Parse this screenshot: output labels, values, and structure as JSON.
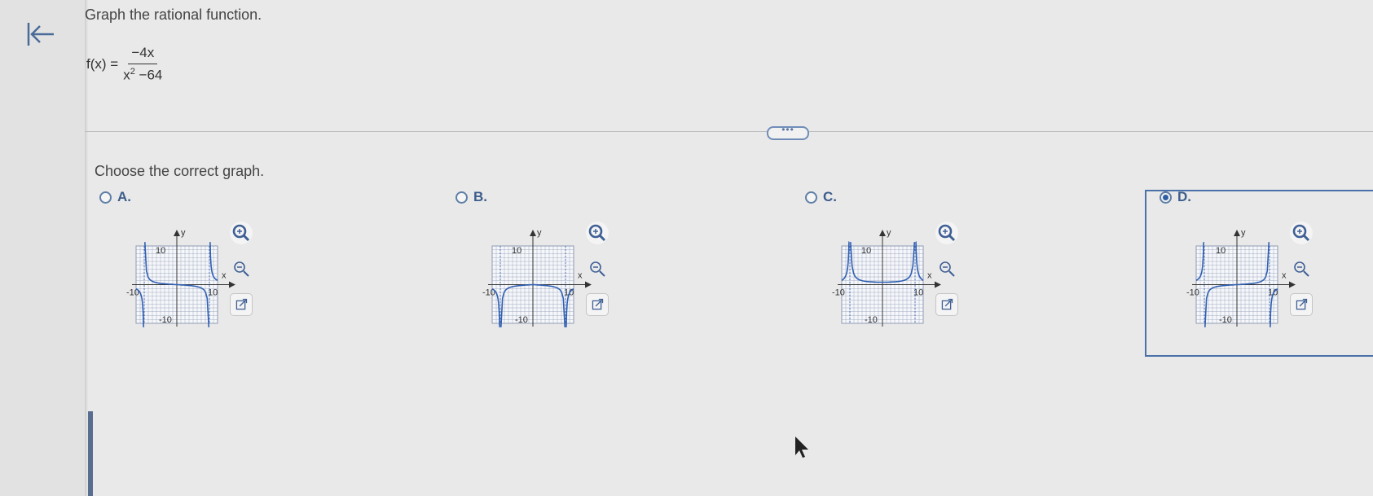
{
  "nav": {
    "back_icon": "arrow-left-bar-icon"
  },
  "question": {
    "instruction": "Graph the rational function.",
    "function_lhs": "f(x) =",
    "numerator": "−4x",
    "denominator_base": "x",
    "denominator_exp": "2",
    "denominator_rest": " −64"
  },
  "prompt": "Choose the correct graph.",
  "options": [
    {
      "letter": "A.",
      "selected": false,
      "axis_labels": {
        "x": "x",
        "y": "y",
        "xmin": "-10",
        "xmax": "10",
        "ymin": "-10",
        "ymax": "10"
      }
    },
    {
      "letter": "B.",
      "selected": false,
      "axis_labels": {
        "x": "x",
        "y": "y",
        "xmin": "-10",
        "xmax": "10",
        "ymin": "-10",
        "ymax": "10"
      }
    },
    {
      "letter": "C.",
      "selected": false,
      "axis_labels": {
        "x": "x",
        "y": "y",
        "xmin": "-10",
        "xmax": "10",
        "ymin": "-10",
        "ymax": "10"
      }
    },
    {
      "letter": "D.",
      "selected": true,
      "axis_labels": {
        "x": "x",
        "y": "y",
        "xmin": "-10",
        "xmax": "10",
        "ymin": "-10",
        "ymax": "10"
      }
    }
  ],
  "tool_icons": [
    "zoom-in-icon",
    "zoom-out-icon",
    "open-new-window-icon"
  ],
  "colors": {
    "accent": "#2e5ea1",
    "curve": "#2f5fb3",
    "grid": "#8e9bb2"
  }
}
